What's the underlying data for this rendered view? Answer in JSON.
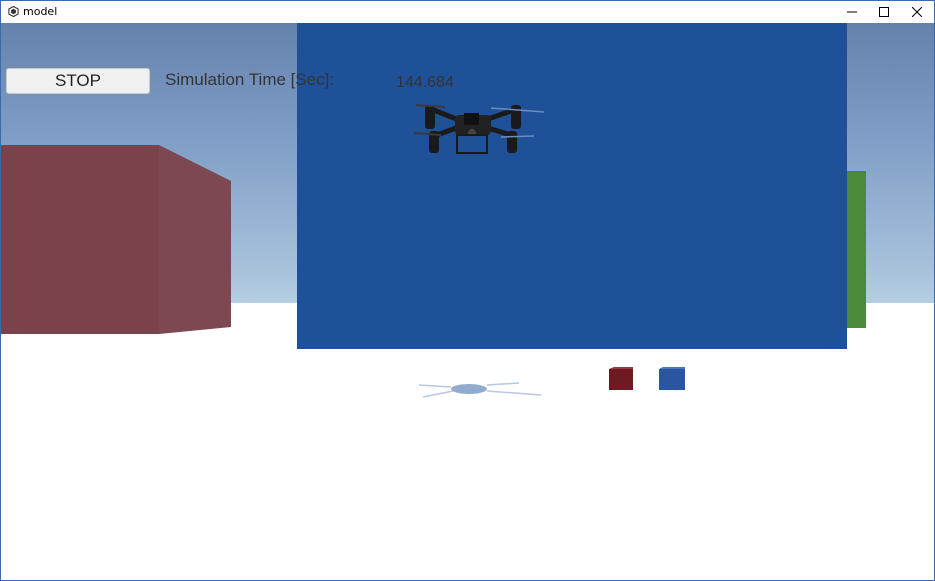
{
  "window": {
    "title": "model"
  },
  "controls": {
    "stop_label": "STOP"
  },
  "simulation": {
    "time_label": "Simulation Time [Sec]:",
    "time_value": "144.684"
  },
  "icons": {
    "app": "unity-icon",
    "minimize": "minimize-icon",
    "maximize": "maximize-icon",
    "close": "close-icon"
  },
  "colors": {
    "blue_panel": "#1f5199",
    "red_building": "#7a424b",
    "green_building": "#4a8a3a",
    "red_cube": "#7a1f25",
    "blue_cube": "#2a55a0"
  }
}
